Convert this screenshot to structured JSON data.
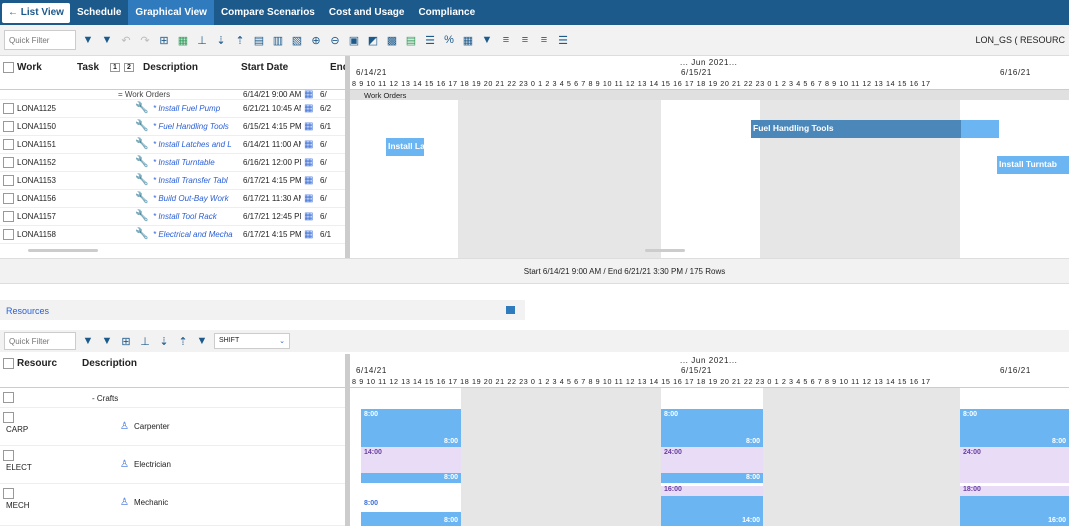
{
  "nav": {
    "back_label": "List View",
    "tabs": [
      {
        "label": "Schedule"
      },
      {
        "label": "Graphical View"
      },
      {
        "label": "Compare Scenarios"
      },
      {
        "label": "Cost and Usage"
      },
      {
        "label": "Compliance"
      }
    ]
  },
  "toolbar": {
    "quick_filter_placeholder": "Quick Filter",
    "account": "LON_GS ( RESOURC"
  },
  "grid": {
    "headers": {
      "work": "Work",
      "task": "Task",
      "level1": "1",
      "level2": "2",
      "description": "Description",
      "start": "Start Date",
      "end": "End"
    },
    "group_row": {
      "label": "= Work Orders",
      "start": "6/14/21 9:00 AM",
      "end": "6/"
    },
    "rows": [
      {
        "wo": "LONA1125",
        "desc": "* Install Fuel Pump",
        "start": "6/21/21 10:45 AM",
        "end": "6/2"
      },
      {
        "wo": "LONA1150",
        "desc": "* Fuel Handling Tools",
        "start": "6/15/21 4:15 PM",
        "end": "6/1"
      },
      {
        "wo": "LONA1151",
        "desc": "* Install Latches and L",
        "start": "6/14/21 11:00 AM",
        "end": "6/"
      },
      {
        "wo": "LONA1152",
        "desc": "* Install Turntable",
        "start": "6/16/21 12:00 PM",
        "end": "6/"
      },
      {
        "wo": "LONA1153",
        "desc": "* Install Transfer Tabl",
        "start": "6/17/21 4:15 PM",
        "end": "6/"
      },
      {
        "wo": "LONA1156",
        "desc": "* Build Out-Bay Work",
        "start": "6/17/21 11:30 AM",
        "end": "6/"
      },
      {
        "wo": "LONA1157",
        "desc": "* Install Tool Rack",
        "start": "6/17/21 12:45 PM",
        "end": "6/"
      },
      {
        "wo": "LONA1158",
        "desc": "* Electrical and Mecha",
        "start": "6/17/21 4:15 PM",
        "end": "6/1"
      }
    ]
  },
  "timeline": {
    "month": "... Jun 2021...",
    "dates": [
      "6/14/21",
      "6/15/21",
      "6/16/21"
    ],
    "hours1": "8 9 10 11 12 13 14 15 16 17 18 19 20 21 22 23 0 1 2 3 4 5 6 7 8 9 10 11 12 13 14 15 16 17 18 19 20 21 22 23 0 1 2 3 4 5 6 7 8 9 10 11 12 13 14 15 16 17",
    "group_label": "Work Orders",
    "bars": [
      "Fuel Handling Tools",
      "Install La",
      "Install Turntab"
    ]
  },
  "status": "Start 6/14/21 9:00 AM / End 6/21/21 3:30 PM / 175 Rows",
  "resources": {
    "title": "Resources",
    "quick_filter_placeholder": "Quick Filter",
    "shift_label": "SHIFT",
    "headers": {
      "resource": "Resourc",
      "description": "Description"
    },
    "group": "- Crafts",
    "rows": [
      {
        "code": "CARP",
        "desc": "Carpenter"
      },
      {
        "code": "ELECT",
        "desc": "Electrician"
      },
      {
        "code": "MECH",
        "desc": "Mechanic"
      }
    ],
    "cap": {
      "carp": [
        "8:00",
        "8:00",
        "8:00",
        "8:00",
        "8:00",
        "8:00"
      ],
      "elect": [
        "14:00",
        "8:00",
        "24:00",
        "8:00",
        "24:00"
      ],
      "mech": [
        "8:00",
        "8:00",
        "16:00",
        "14:00",
        "18:00",
        "16:00"
      ]
    }
  },
  "colors": {
    "nav": "#1d5a8c",
    "active_tab": "#2f7bbd",
    "bar": "#6bb6f2",
    "bar_dark": "#4b87b8",
    "lilac": "#e9dcf7"
  }
}
